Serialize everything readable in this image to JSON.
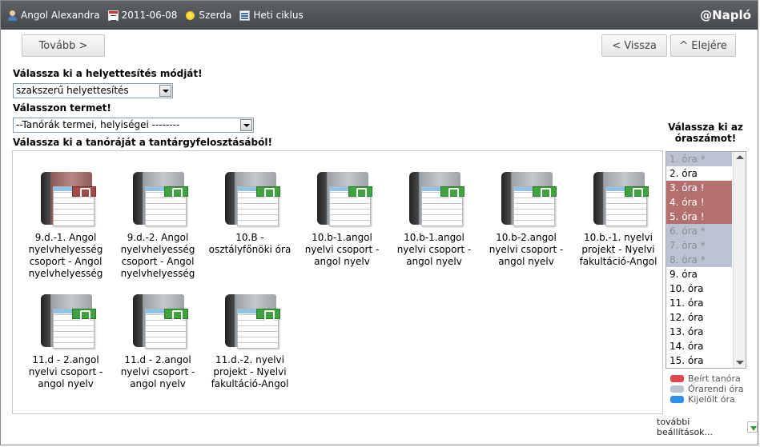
{
  "topbar": {
    "user": "Angol Alexandra",
    "date": "2011-06-08",
    "weekday": "Szerda",
    "cycle": "Heti ciklus",
    "brand": "@Napló"
  },
  "nav": {
    "next": "Tovább >",
    "back": "< Vissza",
    "top": "^ Elejére"
  },
  "form": {
    "mode_label": "Válassza ki a helyettesítés módját!",
    "mode_value": "szakszerű helyettesítés",
    "room_label": "Válasszon termet!",
    "room_value": "--Tanórák termei, helyiségei --------",
    "lesson_label": "Válassza ki a tanóráját a tantárgyfelosztásából!"
  },
  "lessons": [
    {
      "text": "9.d.-1. Angol nyelvhelyesség csoport - Angol nyelvhelyesség",
      "icon": "red-book-icon"
    },
    {
      "text": "9.d.-2. Angol nyelvhelyesség csoport - Angol nyelvhelyesség",
      "icon": "green-book-icon"
    },
    {
      "text": "10.B - osztályfőnöki óra",
      "icon": "green-book-icon"
    },
    {
      "text": "10.b-1.angol nyelvi csoport - angol nyelv",
      "icon": "green-book-icon"
    },
    {
      "text": "10.b-1.angol nyelvi csoport - angol nyelv",
      "icon": "green-book-icon"
    },
    {
      "text": "10.b-2.angol nyelvi csoport - angol nyelv",
      "icon": "green-book-icon"
    },
    {
      "text": "10.b.-1. nyelvi projekt - Nyelvi fakultáció-Angol",
      "icon": "green-book-icon"
    },
    {
      "text": "11.d - 2.angol nyelvi csoport - angol nyelv",
      "icon": "green-book-icon"
    },
    {
      "text": "11.d - 2.angol nyelvi csoport - angol nyelv",
      "icon": "green-book-icon"
    },
    {
      "text": "11.d.-2. nyelvi projekt - Nyelvi fakultáció-Angol",
      "icon": "green-book-icon"
    }
  ],
  "hours": {
    "title": "Válassza ki az óraszámot!",
    "items": [
      {
        "label": "1. óra *",
        "state": "orarendi"
      },
      {
        "label": "2. óra",
        "state": "free"
      },
      {
        "label": "3. óra !",
        "state": "beirt"
      },
      {
        "label": "4. óra !",
        "state": "beirt"
      },
      {
        "label": "5. óra !",
        "state": "beirt"
      },
      {
        "label": "6. óra *",
        "state": "orarendi"
      },
      {
        "label": "7. óra *",
        "state": "orarendi"
      },
      {
        "label": "8. óra *",
        "state": "orarendi"
      },
      {
        "label": "9. óra",
        "state": "free"
      },
      {
        "label": "10. óra",
        "state": "free"
      },
      {
        "label": "11. óra",
        "state": "free"
      },
      {
        "label": "12. óra",
        "state": "free"
      },
      {
        "label": "13. óra",
        "state": "free"
      },
      {
        "label": "14. óra",
        "state": "free"
      },
      {
        "label": "15. óra",
        "state": "free"
      }
    ]
  },
  "legend": [
    {
      "label": "Beírt tanóra",
      "color": "#e0474c"
    },
    {
      "label": "Órarendi óra",
      "color": "#b9c3d1"
    },
    {
      "label": "Kijelölt óra",
      "color": "#2f8ff0"
    }
  ],
  "more_settings": "további beállítások..."
}
